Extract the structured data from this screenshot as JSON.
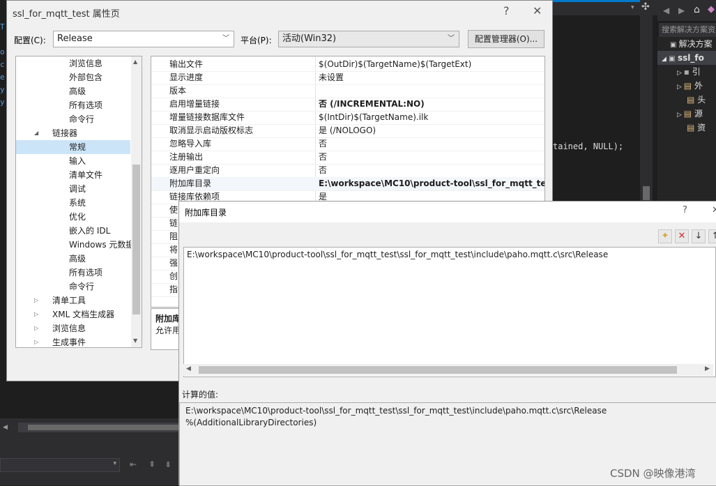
{
  "property_dialog": {
    "title": "ssl_for_mqtt_test 属性页",
    "help_btn": "?",
    "close_btn": "✕",
    "config_label": "配置(C):",
    "config_value": "Release",
    "platform_label": "平台(P):",
    "platform_value": "活动(Win32)",
    "config_manager_btn": "配置管理器(O)...",
    "tree": [
      {
        "label": "浏览信息",
        "level": 2,
        "expander": ""
      },
      {
        "label": "外部包含",
        "level": 2,
        "expander": ""
      },
      {
        "label": "高级",
        "level": 2,
        "expander": ""
      },
      {
        "label": "所有选项",
        "level": 2,
        "expander": ""
      },
      {
        "label": "命令行",
        "level": 2,
        "expander": ""
      },
      {
        "label": "链接器",
        "level": 1,
        "expander": "◢"
      },
      {
        "label": "常规",
        "level": 2,
        "expander": "",
        "selected": true
      },
      {
        "label": "输入",
        "level": 2,
        "expander": ""
      },
      {
        "label": "清单文件",
        "level": 2,
        "expander": ""
      },
      {
        "label": "调试",
        "level": 2,
        "expander": ""
      },
      {
        "label": "系统",
        "level": 2,
        "expander": ""
      },
      {
        "label": "优化",
        "level": 2,
        "expander": ""
      },
      {
        "label": "嵌入的 IDL",
        "level": 2,
        "expander": ""
      },
      {
        "label": "Windows 元数据",
        "level": 2,
        "expander": ""
      },
      {
        "label": "高级",
        "level": 2,
        "expander": ""
      },
      {
        "label": "所有选项",
        "level": 2,
        "expander": ""
      },
      {
        "label": "命令行",
        "level": 2,
        "expander": ""
      },
      {
        "label": "清单工具",
        "level": 1,
        "expander": "▷"
      },
      {
        "label": "XML 文档生成器",
        "level": 1,
        "expander": "▷"
      },
      {
        "label": "浏览信息",
        "level": 1,
        "expander": "▷"
      },
      {
        "label": "生成事件",
        "level": 1,
        "expander": "▷"
      }
    ],
    "properties": [
      {
        "name": "输出文件",
        "value": "$(OutDir)$(TargetName)$(TargetExt)",
        "bold": false
      },
      {
        "name": "显示进度",
        "value": "未设置",
        "bold": false
      },
      {
        "name": "版本",
        "value": "",
        "bold": false
      },
      {
        "name": "启用增量链接",
        "value": "否 (/INCREMENTAL:NO)",
        "bold": true
      },
      {
        "name": "增量链接数据库文件",
        "value": "$(IntDir)$(TargetName).ilk",
        "bold": false
      },
      {
        "name": "取消显示启动版权标志",
        "value": "是 (/NOLOGO)",
        "bold": false
      },
      {
        "name": "忽略导入库",
        "value": "否",
        "bold": false
      },
      {
        "name": "注册输出",
        "value": "否",
        "bold": false
      },
      {
        "name": "逐用户重定向",
        "value": "否",
        "bold": false
      },
      {
        "name": "附加库目录",
        "value": "E:\\workspace\\MC10\\product-tool\\ssl_for_mqtt_test\\s",
        "bold": true
      },
      {
        "name": "链接库依赖项",
        "value": "是",
        "bold": false
      },
      {
        "name": "使",
        "value": "",
        "bold": false
      },
      {
        "name": "链",
        "value": "",
        "bold": false
      },
      {
        "name": "阻",
        "value": "",
        "bold": false
      },
      {
        "name": "将",
        "value": "",
        "bold": false
      },
      {
        "name": "强",
        "value": "",
        "bold": false
      },
      {
        "name": "创",
        "value": "",
        "bold": false
      },
      {
        "name": "指",
        "value": "",
        "bold": false
      }
    ],
    "desc_title": "附加库",
    "desc_text": "允许用"
  },
  "libdir_dialog": {
    "title": "附加库目录",
    "help_btn": "?",
    "close_btn": "✕",
    "toolbar": {
      "new_line": "new-folder-icon",
      "delete": "delete-icon",
      "move_down": "arrow-down-icon",
      "move_up": "arrow-up-icon"
    },
    "entries": [
      "E:\\workspace\\MC10\\product-tool\\ssl_for_mqtt_test\\ssl_for_mqtt_test\\include\\paho.mqtt.c\\src\\Release"
    ],
    "calc_label": "计算的值:",
    "calc_values": [
      "E:\\workspace\\MC10\\product-tool\\ssl_for_mqtt_test\\ssl_for_mqtt_test\\include\\paho.mqtt.c\\src\\Release",
      "%(AdditionalLibraryDirectories)"
    ]
  },
  "ide": {
    "code_fragment": "tained, NULL);",
    "solution_search": "搜索解决方案资",
    "solution_rows": [
      "解决方案",
      "ssl_fo",
      "引",
      "外",
      "头",
      "源",
      "资"
    ]
  },
  "watermark": "CSDN @映像港湾"
}
